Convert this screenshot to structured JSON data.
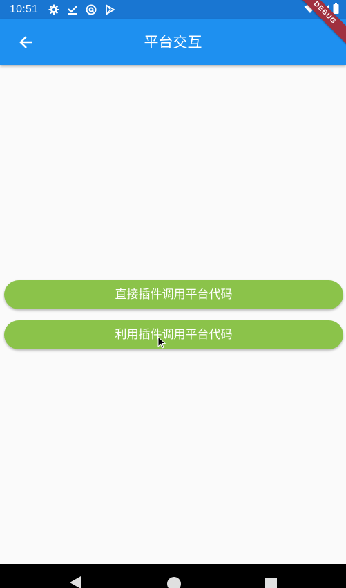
{
  "status_bar": {
    "time": "10:51",
    "icons": [
      "gear-icon",
      "download-done-icon",
      "at-sign-icon",
      "play-store-icon"
    ],
    "right_icons": [
      "wifi-icon",
      "signal-icon",
      "battery-icon"
    ]
  },
  "app_bar": {
    "title": "平台交互",
    "back_icon": "arrow-back-icon",
    "background": "#1e90f0"
  },
  "debug_banner": "DEBUG",
  "buttons": [
    {
      "label": "直接插件调用平台代码"
    },
    {
      "label": "利用插件调用平台代码"
    }
  ],
  "colors": {
    "button": "#8bc34a",
    "debug": "#a0303f",
    "status_bar": "#1976d2"
  },
  "nav_bar": {
    "icons": [
      "nav-back-icon",
      "nav-home-icon",
      "nav-recents-icon"
    ]
  }
}
